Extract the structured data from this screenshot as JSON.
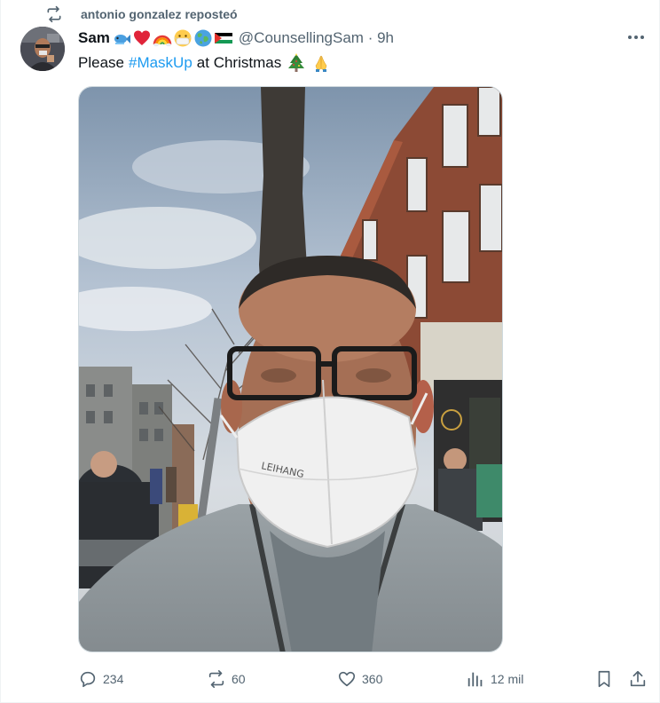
{
  "repost": {
    "icon": "repost-icon",
    "text": "antonio gonzalez reposteó"
  },
  "tweet": {
    "author_name": "Sam",
    "author_emojis": [
      "fish-emoji",
      "red-heart-emoji",
      "rainbow-emoji",
      "face-with-medical-mask-emoji",
      "globe-emoji",
      "palestine-flag-emoji"
    ],
    "handle": "@CounsellingSam · 9h",
    "text_before": "Please",
    "hashtag": "#MaskUp",
    "text_after": "at Christmas",
    "text_emojis": [
      "christmas-tree-emoji",
      "folded-hands-emoji"
    ]
  },
  "actions": {
    "replies": {
      "icon": "reply-icon",
      "count": "234"
    },
    "reposts": {
      "icon": "repost-icon",
      "count": "60"
    },
    "likes": {
      "icon": "like-icon",
      "count": "360"
    },
    "views": {
      "icon": "views-icon",
      "count": "12 mil"
    },
    "bookmark": {
      "icon": "bookmark-icon"
    },
    "share": {
      "icon": "share-icon"
    }
  },
  "colors": {
    "accent": "#1d9bf0",
    "secondary_text": "#536471",
    "primary_text": "#0f1419",
    "border": "#cfd9de"
  }
}
